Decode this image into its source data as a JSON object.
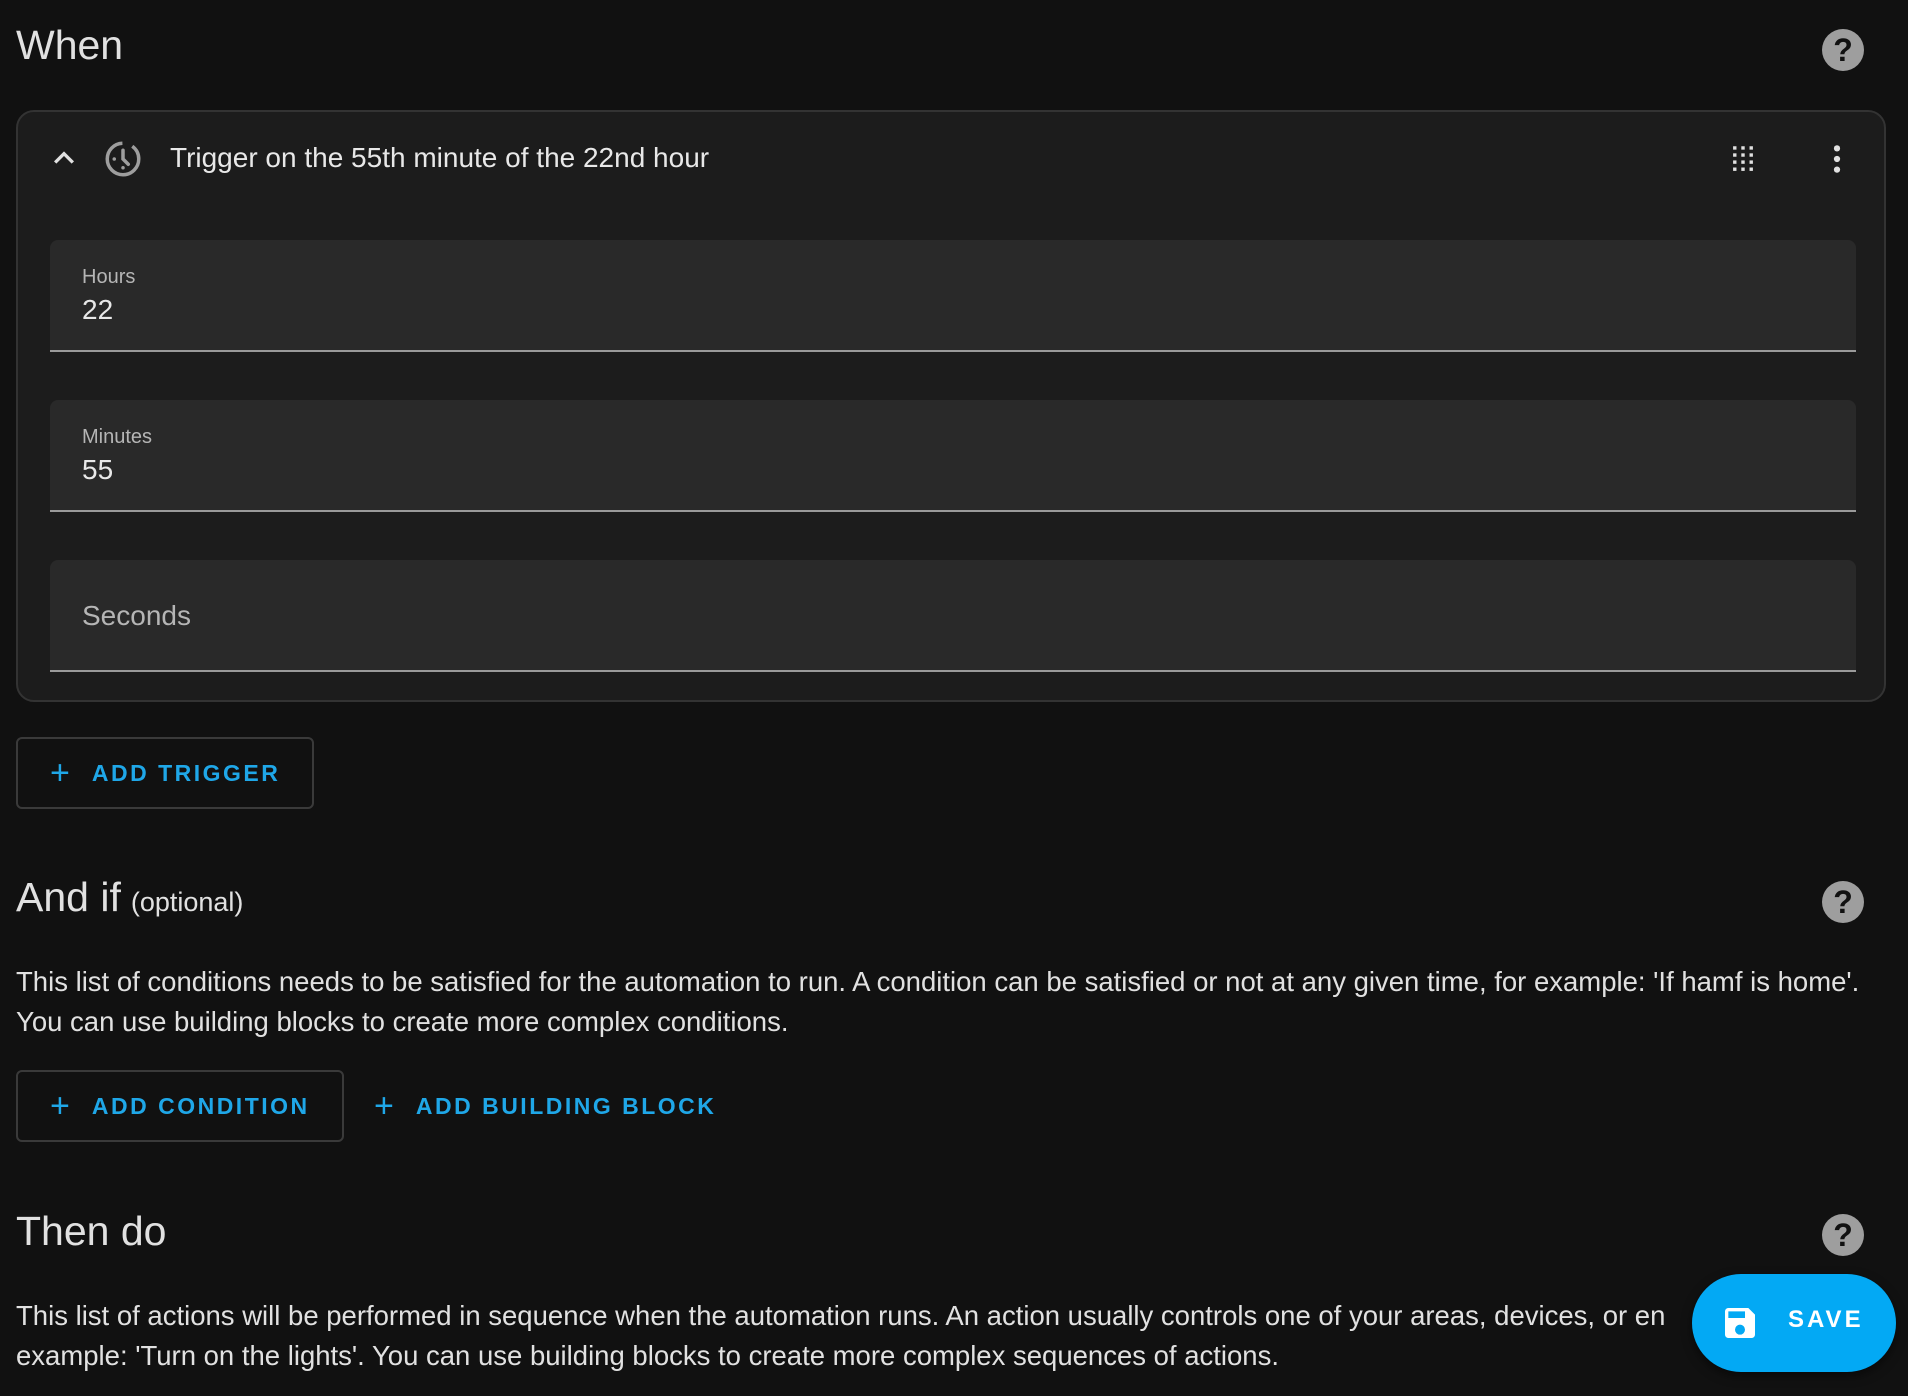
{
  "when": {
    "title": "When",
    "help_icon": "help-circle-icon",
    "trigger": {
      "title": "Trigger on the 55th minute of the 22nd hour",
      "icon": "clock-outline-icon",
      "fields": {
        "hours": {
          "label": "Hours",
          "value": "22"
        },
        "minutes": {
          "label": "Minutes",
          "value": "55"
        },
        "seconds": {
          "label": "",
          "placeholder": "Seconds",
          "value": ""
        }
      }
    },
    "add_trigger_label": "ADD TRIGGER"
  },
  "and_if": {
    "title": "And if",
    "suffix": "(optional)",
    "help_icon": "help-circle-icon",
    "description": "This list of conditions needs to be satisfied for the automation to run. A condition can be satisfied or not at any given time, for example: 'If hamf is home'. You can use building blocks to create more complex conditions.",
    "add_condition_label": "ADD CONDITION",
    "add_building_block_label": "ADD BUILDING BLOCK"
  },
  "then_do": {
    "title": "Then do",
    "help_icon": "help-circle-icon",
    "description": "This list of actions will be performed in sequence when the automation runs. An action usually controls one of your areas, devices, or en",
    "description_line2": "example: 'Turn on the lights'. You can use building blocks to create more complex sequences of actions."
  },
  "save_button": {
    "label": "SAVE",
    "icon": "content-save-icon"
  },
  "colors": {
    "background": "#111111",
    "card": "#1c1c1c",
    "field": "#292929",
    "accent": "#1fa7e8",
    "fab": "#03a9f4"
  }
}
